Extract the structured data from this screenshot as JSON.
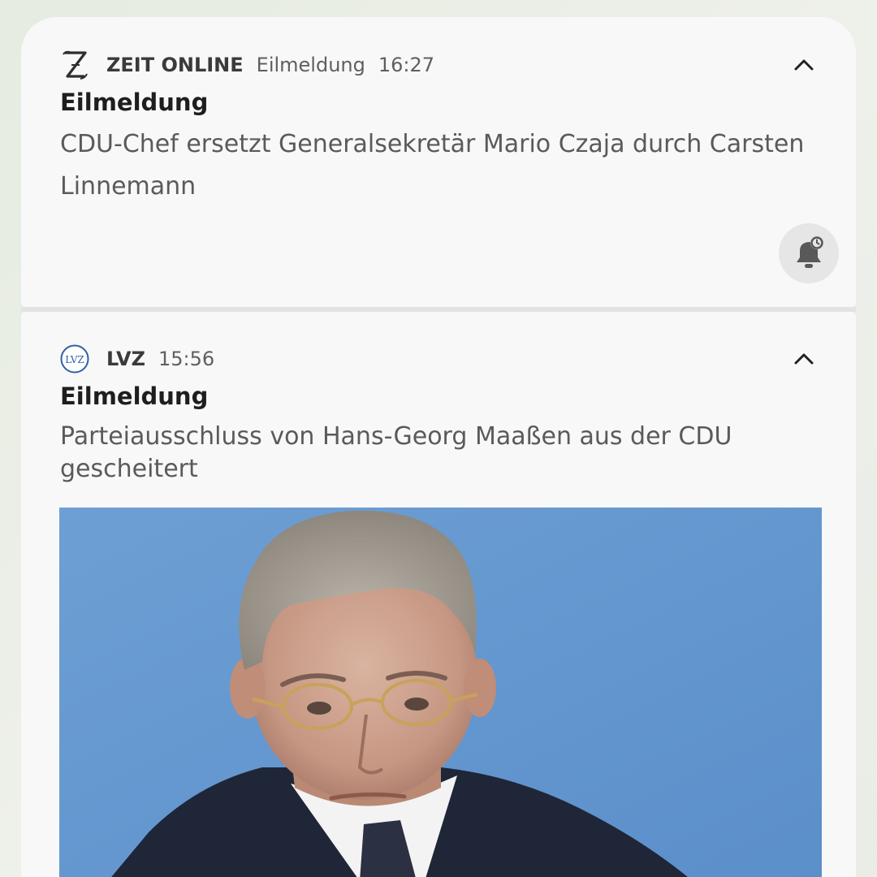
{
  "notifications": [
    {
      "app_name": "ZEIT ONLINE",
      "channel": "Eilmeldung",
      "time": "16:27",
      "app_icon": "zeit-z-logo",
      "title": "Eilmeldung",
      "text": "CDU-Chef ersetzt Generalsekretär Mario Czaja durch Carsten Linnemann",
      "actions": {
        "collapse_icon": "chevron-up-icon",
        "snooze_icon": "bell-snooze-icon"
      }
    },
    {
      "app_name": "LVZ",
      "time": "15:56",
      "app_icon": "lvz-logo",
      "app_icon_text": "LVZ",
      "title": "Eilmeldung",
      "text": "Parteiausschluss von Hans-Georg Maaßen aus der CDU gescheitert",
      "image": "news-photo-portrait",
      "actions": {
        "collapse_icon": "chevron-up-icon"
      }
    }
  ],
  "colors": {
    "panel": "#f8f8f8",
    "lvz_blue": "#2f5fa8",
    "photo_background": "#6e9fd3"
  }
}
